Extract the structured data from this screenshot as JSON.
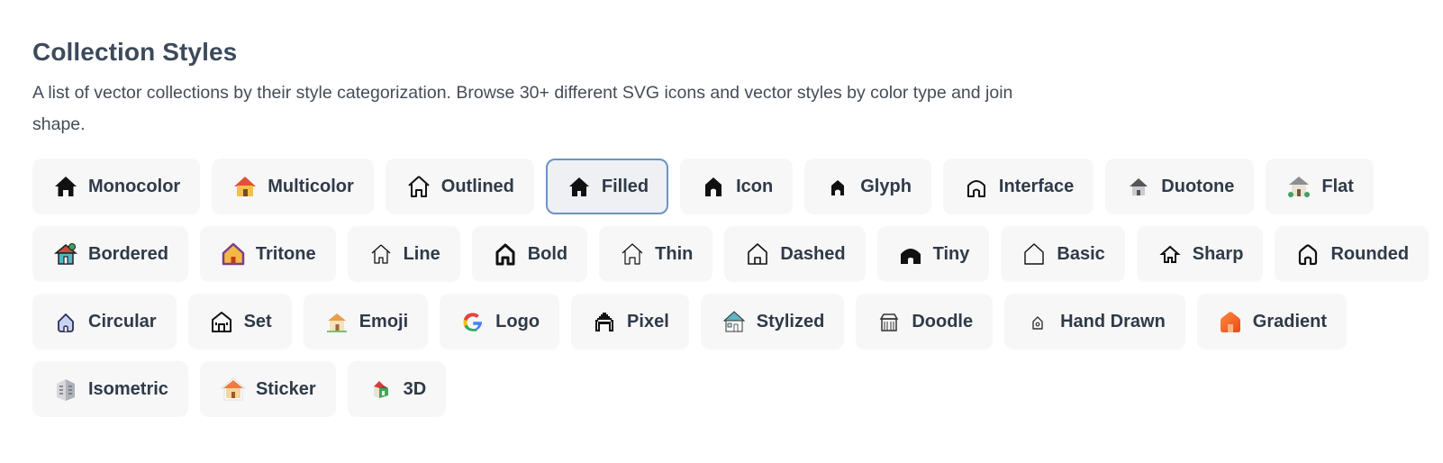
{
  "header": {
    "title": "Collection Styles",
    "description": "A list of vector collections by their style categorization. Browse 30+ different SVG icons and vector styles by color type and join shape."
  },
  "active_chip": "Filled",
  "rows": [
    [
      {
        "label": "Monocolor",
        "icon": "house-monocolor-icon"
      },
      {
        "label": "Multicolor",
        "icon": "house-multicolor-icon"
      },
      {
        "label": "Outlined",
        "icon": "house-outlined-icon"
      },
      {
        "label": "Filled",
        "icon": "house-filled-icon"
      },
      {
        "label": "Icon",
        "icon": "house-icon-style-icon"
      },
      {
        "label": "Glyph",
        "icon": "house-glyph-icon"
      },
      {
        "label": "Interface",
        "icon": "house-interface-icon"
      },
      {
        "label": "Duotone",
        "icon": "house-duotone-icon"
      },
      {
        "label": "Flat",
        "icon": "house-flat-icon"
      }
    ],
    [
      {
        "label": "Bordered",
        "icon": "house-bordered-icon"
      },
      {
        "label": "Tritone",
        "icon": "house-tritone-icon"
      },
      {
        "label": "Line",
        "icon": "house-line-icon"
      },
      {
        "label": "Bold",
        "icon": "house-bold-icon"
      },
      {
        "label": "Thin",
        "icon": "house-thin-icon"
      },
      {
        "label": "Dashed",
        "icon": "house-dashed-icon"
      },
      {
        "label": "Tiny",
        "icon": "house-tiny-icon"
      },
      {
        "label": "Basic",
        "icon": "house-basic-icon"
      },
      {
        "label": "Sharp",
        "icon": "house-sharp-icon"
      },
      {
        "label": "Rounded",
        "icon": "house-rounded-icon"
      }
    ],
    [
      {
        "label": "Circular",
        "icon": "house-circular-icon"
      },
      {
        "label": "Set",
        "icon": "house-set-icon"
      },
      {
        "label": "Emoji",
        "icon": "house-emoji-icon"
      },
      {
        "label": "Logo",
        "icon": "google-logo-icon"
      },
      {
        "label": "Pixel",
        "icon": "house-pixel-icon"
      },
      {
        "label": "Stylized",
        "icon": "house-stylized-icon"
      },
      {
        "label": "Doodle",
        "icon": "house-doodle-icon"
      },
      {
        "label": "Hand Drawn",
        "icon": "house-hand-drawn-icon"
      },
      {
        "label": "Gradient",
        "icon": "house-gradient-icon"
      }
    ],
    [
      {
        "label": "Isometric",
        "icon": "building-isometric-icon"
      },
      {
        "label": "Sticker",
        "icon": "house-sticker-icon"
      },
      {
        "label": "3D",
        "icon": "house-3d-icon"
      }
    ]
  ],
  "colors": {
    "chip_bg": "#f7f7f8",
    "active_border": "#6e93c2",
    "text": "#2f3a48",
    "title": "#3d4a5c"
  }
}
